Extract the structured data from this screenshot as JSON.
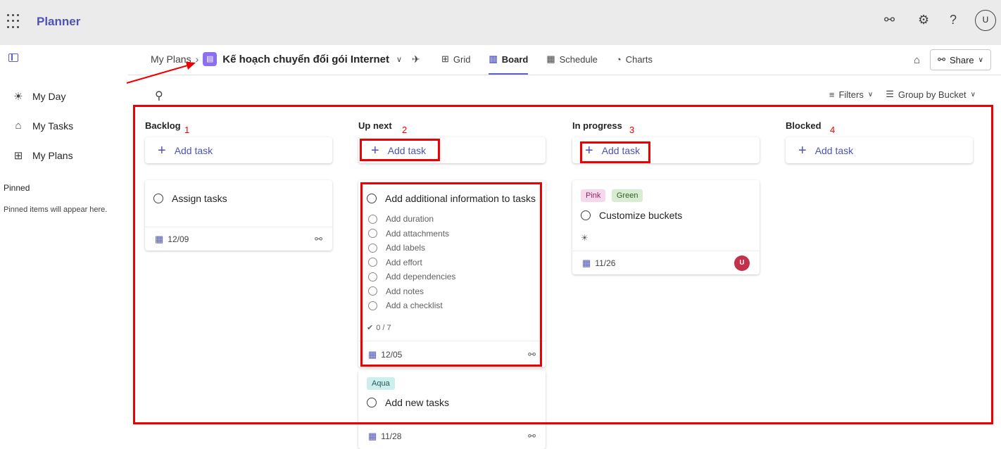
{
  "app": {
    "name": "Planner",
    "avatar": "U"
  },
  "topbar_icons": [
    "people-icon",
    "gear-icon",
    "help-icon"
  ],
  "sidebar": {
    "items": [
      {
        "label": "My Day",
        "icon": "sun-icon"
      },
      {
        "label": "My Tasks",
        "icon": "tasks-icon"
      },
      {
        "label": "My Plans",
        "icon": "plans-icon"
      }
    ],
    "pinned_heading": "Pinned",
    "pinned_empty": "Pinned items will appear here."
  },
  "header": {
    "breadcrumb_root": "My Plans",
    "plan_name": "Kế hoạch chuyển đổi gói Internet",
    "views": [
      {
        "label": "Grid",
        "active": false
      },
      {
        "label": "Board",
        "active": true
      },
      {
        "label": "Schedule",
        "active": false
      },
      {
        "label": "Charts",
        "active": false
      }
    ],
    "share_label": "Share"
  },
  "toolbar": {
    "filters": "Filters",
    "group_by": "Group by Bucket"
  },
  "add_task_label": "Add task",
  "buckets": [
    {
      "name": "Backlog",
      "number": "1"
    },
    {
      "name": "Up next",
      "number": "2"
    },
    {
      "name": "In progress",
      "number": "3"
    },
    {
      "name": "Blocked",
      "number": "4"
    }
  ],
  "cards": {
    "assign_tasks": {
      "title": "Assign tasks",
      "date": "12/09"
    },
    "add_info": {
      "title": "Add additional information to tasks",
      "checklist": [
        "Add duration",
        "Add attachments",
        "Add labels",
        "Add effort",
        "Add dependencies",
        "Add notes",
        "Add a checklist"
      ],
      "progress": "0 / 7",
      "date": "12/05"
    },
    "add_new": {
      "title": "Add new tasks",
      "label": "Aqua",
      "date": "11/28"
    },
    "customize": {
      "title": "Customize buckets",
      "labels": [
        "Pink",
        "Green"
      ],
      "date": "11/26",
      "assignee": "U"
    }
  },
  "colors": {
    "accent": "#5b5fc7",
    "annotation": "#ee0000",
    "pink": "#f7d7ec",
    "green": "#d8ecd2",
    "aqua": "#cdeeed"
  }
}
